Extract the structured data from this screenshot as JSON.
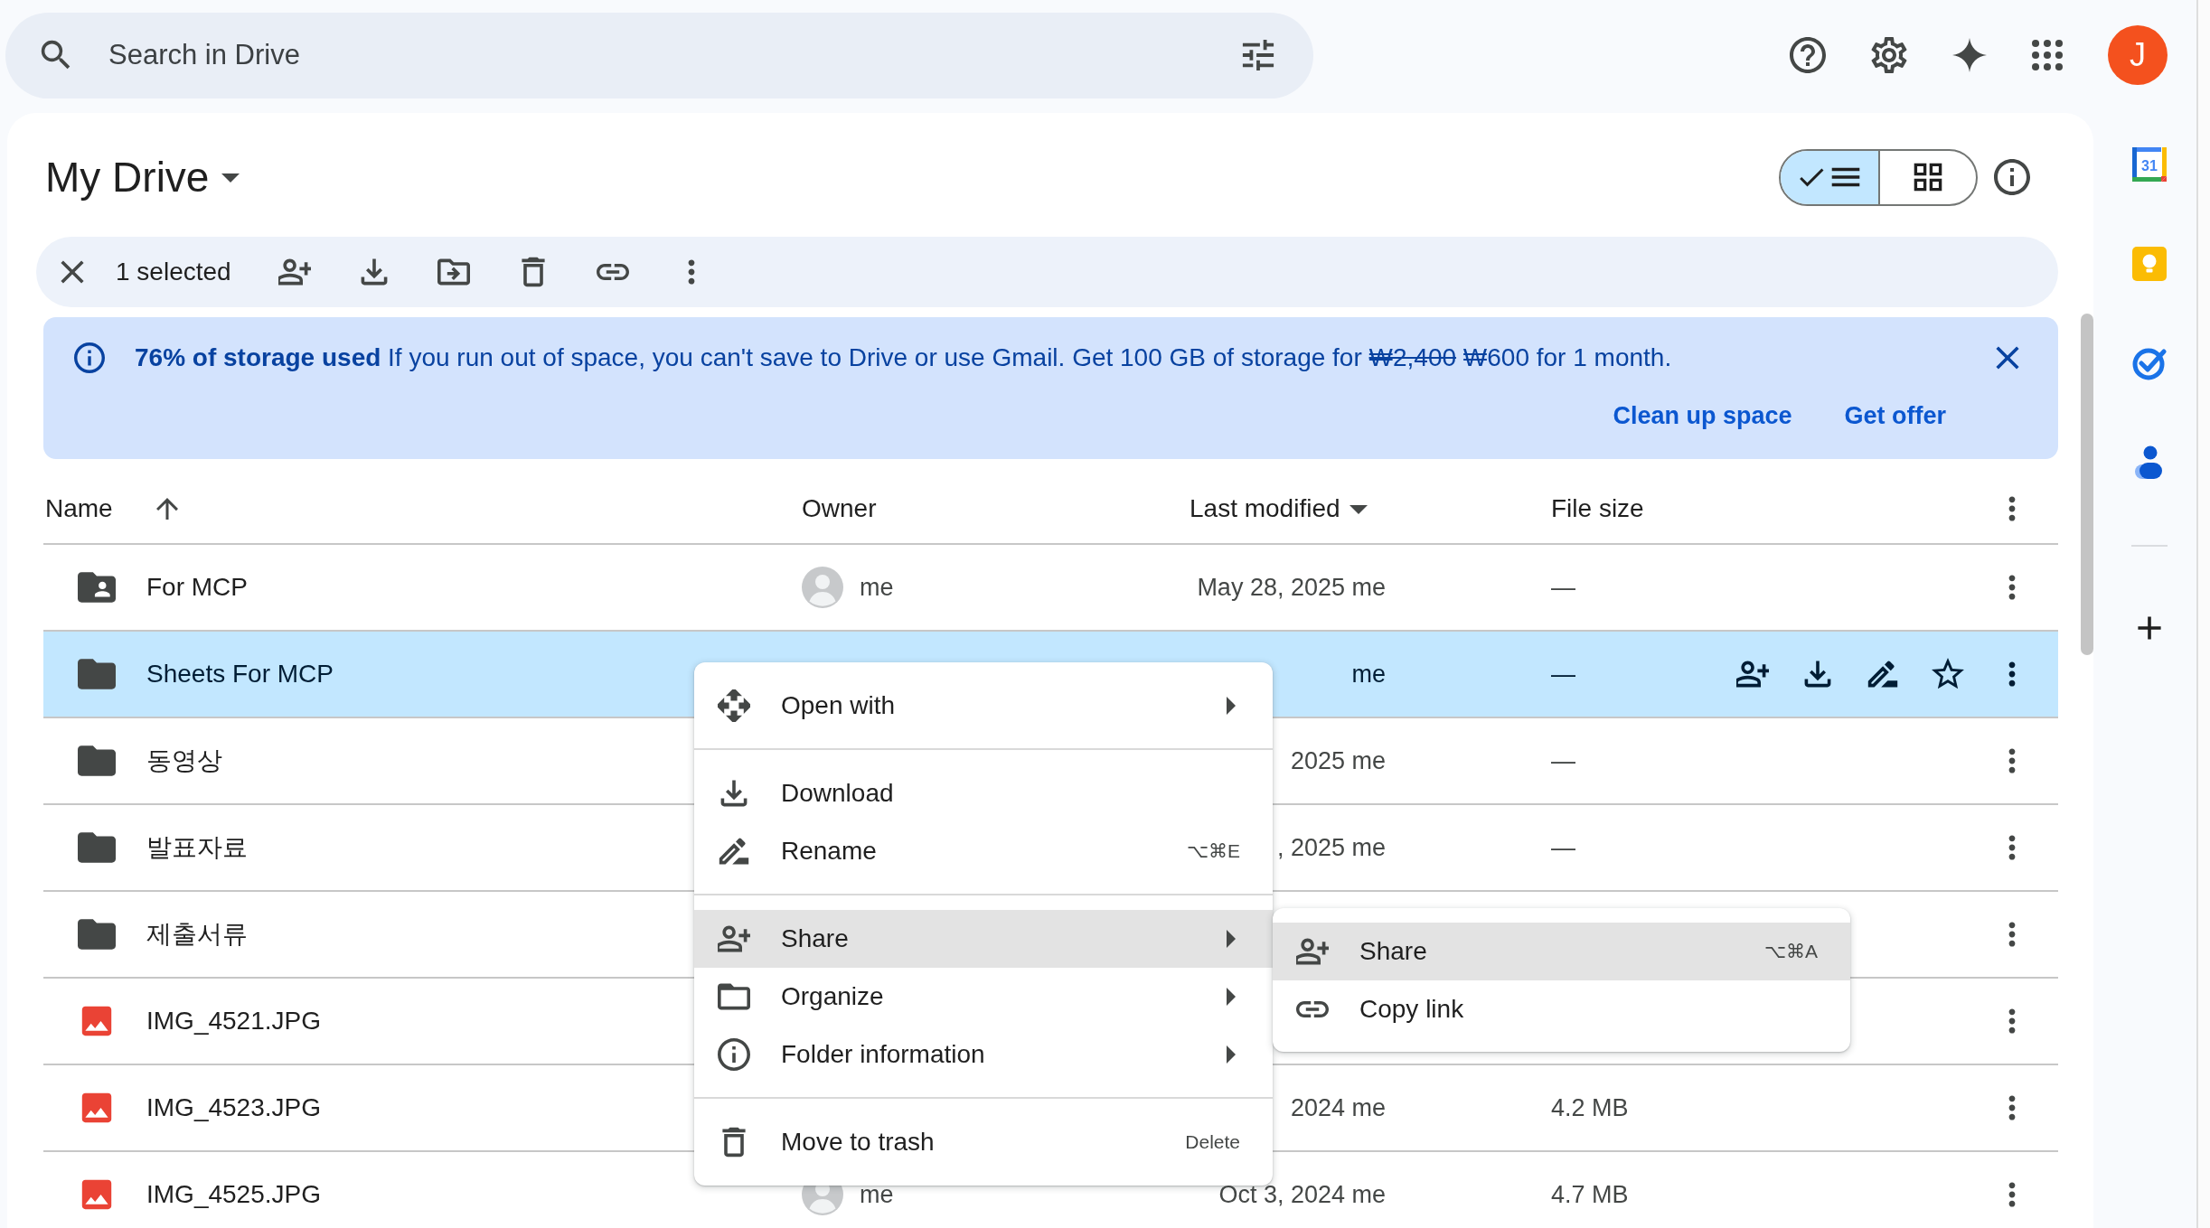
{
  "search": {
    "placeholder": "Search in Drive"
  },
  "account": {
    "initial": "J"
  },
  "title": "My Drive",
  "view_toggle": [
    {
      "kind": "list",
      "selected": true
    },
    {
      "kind": "grid",
      "selected": false
    }
  ],
  "selection_bar": {
    "count": "1 selected"
  },
  "banner": {
    "title": "76% of storage used",
    "message": "If you run out of space, you can't save to Drive or use Gmail. Get 100 GB of storage for",
    "old_price": "₩2,400",
    "price": "₩600 for 1 month.",
    "actions": [
      "Clean up space",
      "Get offer"
    ]
  },
  "table": {
    "columns": [
      {
        "label": "Name",
        "ascending": true
      },
      {
        "label": "Owner"
      },
      {
        "label": "Last modified",
        "menu": true
      },
      {
        "label": "File size"
      }
    ],
    "rows": [
      {
        "kind": "shared-folder",
        "name": "For MCP",
        "owner": "me",
        "modified": "May 28, 2025 me",
        "size": "—",
        "selected": false
      },
      {
        "kind": "folder",
        "name": "Sheets For MCP",
        "modified": "me",
        "size": "—",
        "selected": true
      },
      {
        "kind": "folder",
        "name": "동영상",
        "modified": "2025 me",
        "size": "—",
        "selected": false
      },
      {
        "kind": "folder",
        "name": "발표자료",
        "modified": ", 2025 me",
        "size": "—",
        "selected": false
      },
      {
        "kind": "folder",
        "name": "제출서류",
        "selected": false
      },
      {
        "kind": "image",
        "name": "IMG_4521.JPG",
        "selected": false
      },
      {
        "kind": "image",
        "name": "IMG_4523.JPG",
        "modified": "2024 me",
        "size": "4.2 MB",
        "selected": false
      },
      {
        "kind": "image",
        "name": "IMG_4525.JPG",
        "owner": "me",
        "modified": "Oct 3, 2024 me",
        "size": "4.7 MB",
        "selected": false
      }
    ]
  },
  "context_menu": {
    "sections": [
      [
        {
          "kind": "open",
          "label": "Open with",
          "submenu": true,
          "highlighted": false
        }
      ],
      [
        {
          "kind": "download",
          "label": "Download",
          "submenu": false,
          "highlighted": false
        },
        {
          "kind": "rename",
          "label": "Rename",
          "shortcut": "⌥⌘E",
          "submenu": false,
          "highlighted": false
        }
      ],
      [
        {
          "kind": "share",
          "label": "Share",
          "submenu": true,
          "highlighted": true
        },
        {
          "kind": "organize",
          "label": "Organize",
          "submenu": true,
          "highlighted": false
        },
        {
          "kind": "info",
          "label": "Folder information",
          "submenu": true,
          "highlighted": false
        }
      ],
      [
        {
          "kind": "trash",
          "label": "Move to trash",
          "shortcut": "Delete",
          "submenu": false,
          "highlighted": false
        }
      ]
    ]
  },
  "submenu": {
    "items": [
      {
        "kind": "share",
        "label": "Share",
        "shortcut": "⌥⌘A",
        "submenu": false,
        "highlighted": true
      },
      {
        "kind": "link",
        "label": "Copy link",
        "submenu": false,
        "highlighted": false
      }
    ]
  },
  "sidebar": {
    "apps": [
      {
        "kind": "calendar",
        "label": "31"
      },
      {
        "kind": "keep"
      },
      {
        "kind": "tasks"
      },
      {
        "kind": "contacts"
      }
    ]
  }
}
